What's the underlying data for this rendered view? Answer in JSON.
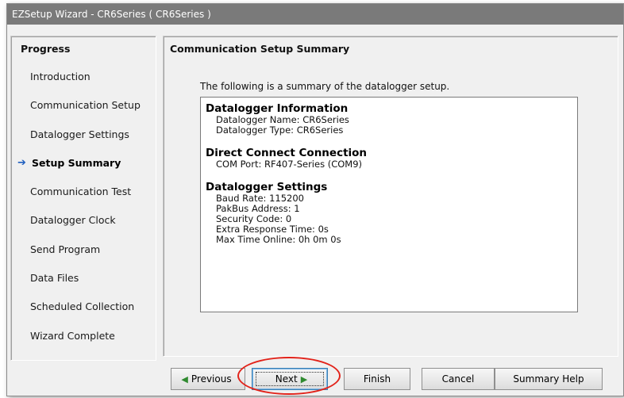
{
  "window": {
    "title": "EZSetup Wizard - CR6Series ( CR6Series )"
  },
  "progress": {
    "title": "Progress",
    "steps": [
      {
        "label": "Introduction"
      },
      {
        "label": "Communication Setup"
      },
      {
        "label": "Datalogger Settings"
      },
      {
        "label": "Setup Summary",
        "current": true
      },
      {
        "label": "Communication Test"
      },
      {
        "label": "Datalogger Clock"
      },
      {
        "label": "Send Program"
      },
      {
        "label": "Data Files"
      },
      {
        "label": "Scheduled Collection"
      },
      {
        "label": "Wizard Complete"
      }
    ]
  },
  "content": {
    "title": "Communication Setup Summary",
    "intro": "The following is a summary of the datalogger setup.",
    "sections": [
      {
        "heading": "Datalogger Information",
        "lines": [
          "Datalogger Name: CR6Series",
          "Datalogger Type: CR6Series"
        ]
      },
      {
        "heading": "Direct Connect Connection",
        "lines": [
          "COM Port: RF407-Series (COM9)"
        ]
      },
      {
        "heading": "Datalogger Settings",
        "lines": [
          "Baud Rate: 115200",
          "PakBus Address: 1",
          "Security Code: 0",
          "Extra Response Time: 0s",
          "Max Time Online: 0h 0m 0s"
        ]
      }
    ]
  },
  "buttons": {
    "previous": "Previous",
    "next": "Next",
    "finish": "Finish",
    "cancel": "Cancel",
    "summary_help": "Summary Help"
  },
  "colors": {
    "arrow": "#1f5fbf",
    "button_triangle": "#2f8a2f",
    "highlight": "#e2231a"
  }
}
